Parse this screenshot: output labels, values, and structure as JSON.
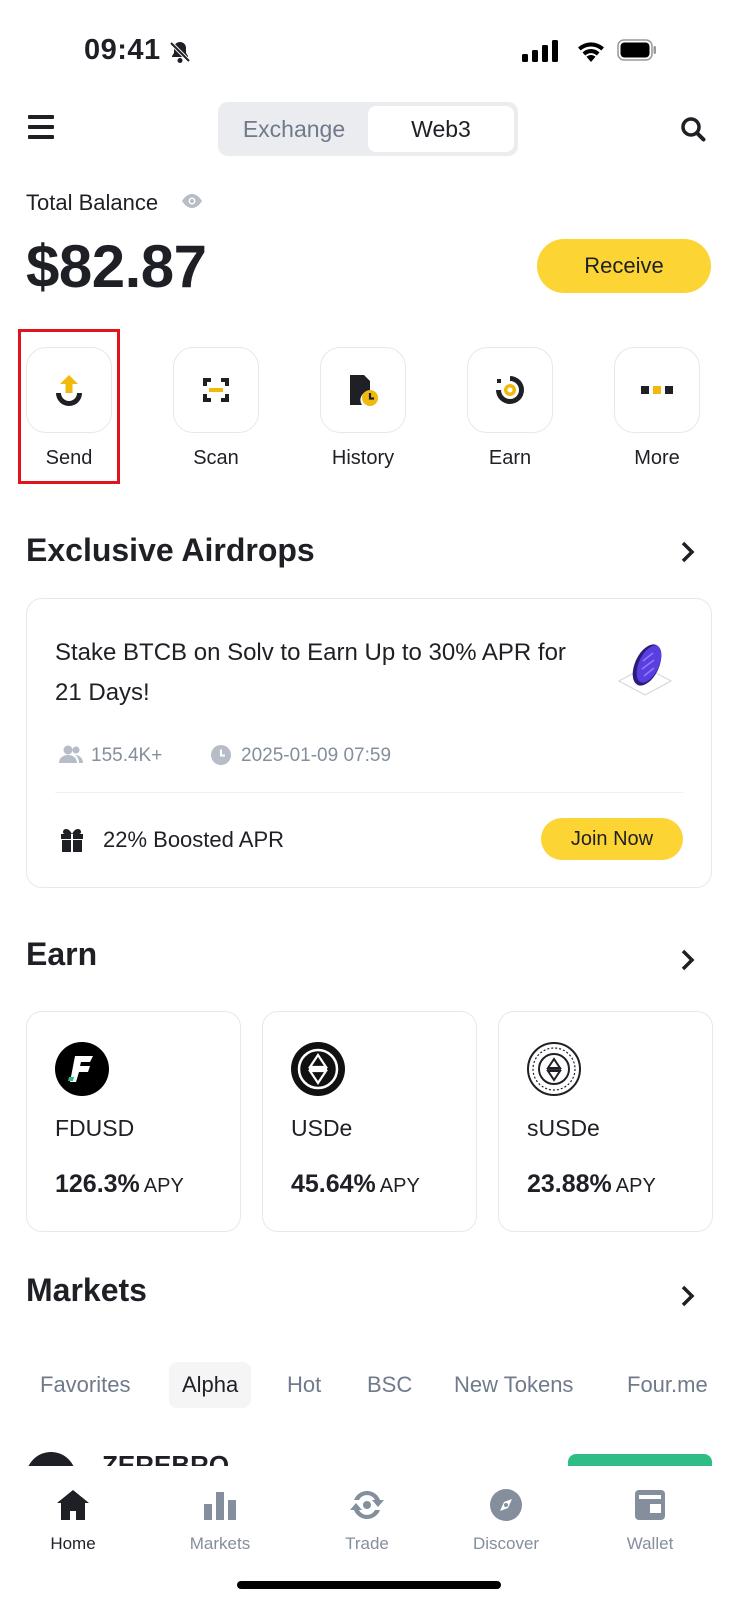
{
  "status_bar": {
    "time": "09:41"
  },
  "header": {
    "tabs": [
      "Exchange",
      "Web3"
    ],
    "active_tab": "Web3"
  },
  "balance": {
    "label": "Total Balance",
    "amount": "$82.87",
    "receive_label": "Receive"
  },
  "actions": [
    {
      "label": "Send",
      "icon": "send-icon"
    },
    {
      "label": "Scan",
      "icon": "scan-icon"
    },
    {
      "label": "History",
      "icon": "history-icon"
    },
    {
      "label": "Earn",
      "icon": "earn-icon"
    },
    {
      "label": "More",
      "icon": "more-icon"
    }
  ],
  "airdrops": {
    "title": "Exclusive Airdrops",
    "card": {
      "title": "Stake BTCB on Solv to Earn Up to 30% APR for 21 Days!",
      "participants": "155.4K+",
      "date": "2025-01-09 07:59",
      "boost": "22% Boosted APR",
      "join_label": "Join Now"
    }
  },
  "earn": {
    "title": "Earn",
    "items": [
      {
        "name": "FDUSD",
        "rate": "126.3%",
        "unit": "APY"
      },
      {
        "name": "USDe",
        "rate": "45.64%",
        "unit": "APY"
      },
      {
        "name": "sUSDe",
        "rate": "23.88%",
        "unit": "APY"
      }
    ]
  },
  "markets": {
    "title": "Markets",
    "tabs": [
      "Favorites",
      "Alpha",
      "Hot",
      "BSC",
      "New Tokens",
      "Four.me"
    ],
    "active_tab": "Alpha",
    "first_row_name": "ZEREBRO"
  },
  "bottom_nav": [
    {
      "label": "Home",
      "icon": "home-icon",
      "active": true
    },
    {
      "label": "Markets",
      "icon": "markets-icon",
      "active": false
    },
    {
      "label": "Trade",
      "icon": "trade-icon",
      "active": false
    },
    {
      "label": "Discover",
      "icon": "discover-icon",
      "active": false
    },
    {
      "label": "Wallet",
      "icon": "wallet-icon",
      "active": false
    }
  ],
  "colors": {
    "brand_yellow": "#fcd535",
    "highlight_red": "#e0141e",
    "text_primary": "#1e2026",
    "text_secondary": "#848e9c"
  }
}
